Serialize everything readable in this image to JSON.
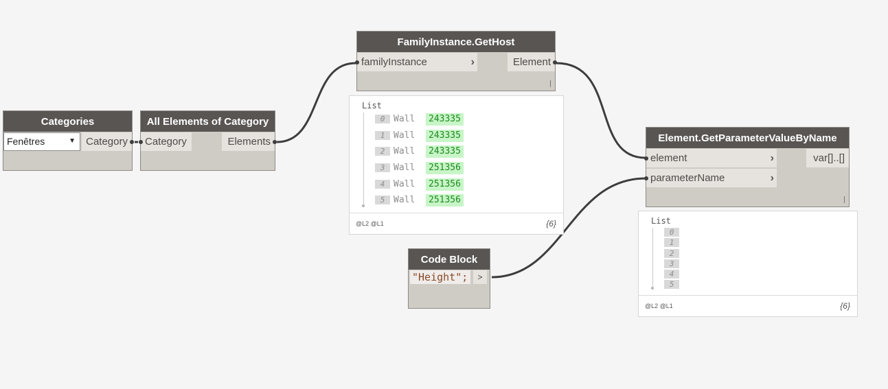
{
  "nodes": {
    "categories": {
      "title": "Categories",
      "dropdown_value": "Fenêtres",
      "output": "Category"
    },
    "all_elements": {
      "title": "All Elements of Category",
      "input": "Category",
      "output": "Elements"
    },
    "get_host": {
      "title": "FamilyInstance.GetHost",
      "input": "familyInstance",
      "output": "Element"
    },
    "get_param": {
      "title": "Element.GetParameterValueByName",
      "inputs": [
        "element",
        "parameterName"
      ],
      "output": "var[]..[]"
    },
    "code_block": {
      "title": "Code Block",
      "code": "\"Height\";",
      "output_symbol": ">"
    }
  },
  "preview_host": {
    "header": "List",
    "rows": [
      {
        "index": "0",
        "type": "Wall",
        "value": "243335"
      },
      {
        "index": "1",
        "type": "Wall",
        "value": "243335"
      },
      {
        "index": "2",
        "type": "Wall",
        "value": "243335"
      },
      {
        "index": "3",
        "type": "Wall",
        "value": "251356"
      },
      {
        "index": "4",
        "type": "Wall",
        "value": "251356"
      },
      {
        "index": "5",
        "type": "Wall",
        "value": "251356"
      }
    ],
    "levels": "@L2 @L1",
    "count": "{6}"
  },
  "preview_param": {
    "header": "List",
    "rows": [
      {
        "index": "0"
      },
      {
        "index": "1"
      },
      {
        "index": "2"
      },
      {
        "index": "3"
      },
      {
        "index": "4"
      },
      {
        "index": "5"
      }
    ],
    "levels": "@L2 @L1",
    "count": "{6}"
  },
  "colors": {
    "canvas": "#f5f5f5",
    "node_header": "#595553",
    "node_body": "#cfcbc5",
    "port": "#e6e2dd",
    "wire": "#3d3d3d",
    "value_bg": "#c7f5c7",
    "value_text": "#1f8a1f"
  }
}
